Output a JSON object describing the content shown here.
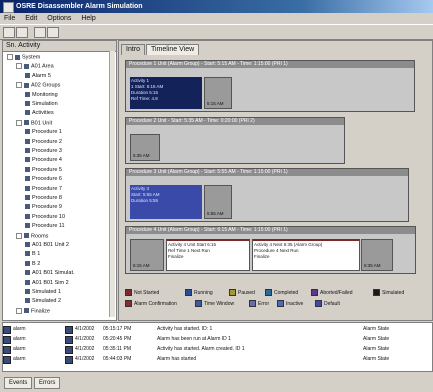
{
  "window": {
    "title": "OSRE Disassembler Alarm Simulation"
  },
  "menu": [
    "File",
    "Edit",
    "Options",
    "Help"
  ],
  "toolbar": {
    "icons": [
      "open-icon",
      "save-icon",
      "refresh-icon",
      "run-icon"
    ]
  },
  "tree": {
    "header": "Sn. Activity",
    "nodes": [
      {
        "label": "System",
        "depth": 0
      },
      {
        "label": "A01 Area",
        "depth": 1
      },
      {
        "label": "Alarm 5",
        "depth": 2
      },
      {
        "label": "A02 Groups",
        "depth": 1
      },
      {
        "label": "Monitoring",
        "depth": 2
      },
      {
        "label": "Simulation",
        "depth": 2
      },
      {
        "label": "Activities",
        "depth": 2
      },
      {
        "label": "B01 Unit",
        "depth": 1
      },
      {
        "label": "Procedure 1",
        "depth": 2
      },
      {
        "label": "Procedure 2",
        "depth": 2
      },
      {
        "label": "Procedure 3",
        "depth": 2
      },
      {
        "label": "Procedure 4",
        "depth": 2
      },
      {
        "label": "Procedure 5",
        "depth": 2
      },
      {
        "label": "Procedure 6",
        "depth": 2
      },
      {
        "label": "Procedure 7",
        "depth": 2
      },
      {
        "label": "Procedure 8",
        "depth": 2
      },
      {
        "label": "Procedure 9",
        "depth": 2
      },
      {
        "label": "Procedure 10",
        "depth": 2
      },
      {
        "label": "Procedure 11",
        "depth": 2
      },
      {
        "label": "Rooms",
        "depth": 1
      },
      {
        "label": "A01 B01 Unit 2",
        "depth": 2
      },
      {
        "label": "B 1",
        "depth": 2
      },
      {
        "label": "B 2",
        "depth": 2
      },
      {
        "label": "A01 B01 Simulat.",
        "depth": 2
      },
      {
        "label": "A01 B01 Sim 2",
        "depth": 2
      },
      {
        "label": "Simulated 1",
        "depth": 2
      },
      {
        "label": "Simulated 2",
        "depth": 2
      },
      {
        "label": "Finalize",
        "depth": 1
      }
    ]
  },
  "tabs": [
    "Intro",
    "Timeline View"
  ],
  "panels": [
    {
      "header": "Procedure 1 Unit (Alarm Group) - Start: 5:15 AM - Time: 1:15:00 (PRI 1)",
      "lines": [
        "Activity 1",
        "1 Start: 5:15 AM",
        "Duration 5:15",
        "Ref Time: 4.8"
      ],
      "small": "5:15 AM"
    },
    {
      "header": "Procedure 2 Unit - Start: 5:35 AM - Time: 0:20:00 (PRI 2)",
      "lines": [],
      "small": "5:35 AM"
    },
    {
      "header": "Procedure 3 Unit (Alarm Group) - Start: 5:55 AM - Time: 1:15:00 (PRI 1)",
      "lines": [
        "Activity 3",
        "Start: 5:55 AM",
        "Duration 5:55"
      ],
      "small": "5:55 AM"
    },
    {
      "header": "Procedure 4 Unit (Alarm Group) - Start: 6:15 AM - Time: 1:15:00 (PRI 1)",
      "lines": [
        "Activity 4 Unit Start 6:15",
        "Ref Time 1 Next Run",
        "Finalize"
      ],
      "lines2": [
        "Activity 4 Next 6:35 (Alarm Group)",
        "Procedure 4 Next Run",
        "Finalize"
      ],
      "small": "6:15 AM",
      "small2": "6:35 AM"
    }
  ],
  "legend": [
    {
      "label": "Not Started",
      "color": "#7a2a2a"
    },
    {
      "label": "Running",
      "color": "#2a4a9a"
    },
    {
      "label": "Paused",
      "color": "#a09a30"
    },
    {
      "label": "Completed",
      "color": "#2a6a9a"
    },
    {
      "label": "Aborted/Failed",
      "color": "#5a3a8a"
    },
    {
      "label": "Simulated",
      "color": "#1a1a1a"
    },
    {
      "label": "Alarm Confirmation",
      "color": "#8a2a2a"
    },
    {
      "label": "Time Window",
      "color": "#3a5aaa"
    },
    {
      "label": "Error",
      "color": "#6a6ab0"
    },
    {
      "label": "Inactive",
      "color": "#4a6ac0"
    },
    {
      "label": "Default",
      "color": "#3a4ab0"
    }
  ],
  "log": [
    {
      "name": "alarm",
      "date": "4/1/2002",
      "time": "05:15:17 PM",
      "msg": "Activity has started. ID: 1",
      "status": "Alarm State"
    },
    {
      "name": "alarm",
      "date": "4/1/2002",
      "time": "05:20:45 PM",
      "msg": "Alarm has been run at Alarm ID 1",
      "status": "Alarm State"
    },
    {
      "name": "alarm",
      "date": "4/1/2002",
      "time": "05:35:11 PM",
      "msg": "Activity has started. Alarm created. ID 1",
      "status": "Alarm State"
    },
    {
      "name": "alarm",
      "date": "4/1/2002",
      "time": "05:44:03 PM",
      "msg": "Alarm has started",
      "status": "Alarm State"
    }
  ],
  "status_tabs": [
    "Events",
    "Errors"
  ]
}
